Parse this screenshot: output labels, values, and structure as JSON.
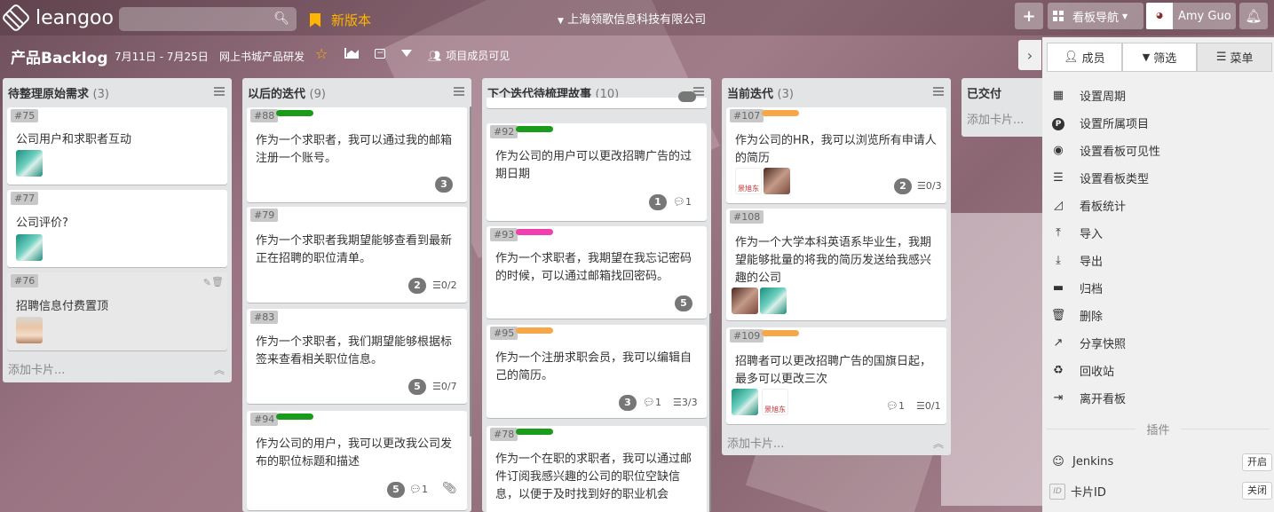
{
  "app": {
    "logo": "leangoo",
    "new_version": "新版本",
    "company": "上海领歌信息科技有限公司",
    "board_nav": "看板导航",
    "user_name": "Amy Guo"
  },
  "board": {
    "title": "产品Backlog",
    "date_range": "7月11日 - 7月25日",
    "project": "网上书城产品研发",
    "members_visibility": "项目成员可见"
  },
  "lists": [
    {
      "title": "待整理原始需求",
      "count": "(3)",
      "add_card": "添加卡片...",
      "cards": [
        {
          "id": "#75",
          "text": "公司用户和求职者互动"
        },
        {
          "id": "#77",
          "text": "公司评价?"
        },
        {
          "id": "#76",
          "text": "招聘信息付费置顶"
        }
      ]
    },
    {
      "title": "以后的迭代",
      "count": "(9)",
      "cards": [
        {
          "id": "#88",
          "text": "作为一个求职者，我可以通过我的邮箱注册一个账号。",
          "badge": "3",
          "label_color": "#1a9c1a"
        },
        {
          "id": "#79",
          "text": "作为一个求职者我期望能够查看到最新正在招聘的职位清单。",
          "badge": "2",
          "checklist": "0/2"
        },
        {
          "id": "#83",
          "text": "作为一个求职者，我们期望能够根据标签来查看相关职位信息。",
          "badge": "5",
          "checklist": "0/7"
        },
        {
          "id": "#94",
          "text": "作为公司的用户，我可以更改我公司发布的职位标题和描述",
          "badge": "5",
          "comments": "1",
          "label_color": "#1a9c1a"
        }
      ]
    },
    {
      "title": "下个迭代待梳理故事",
      "count": "(10)",
      "cards": [
        {
          "id": "#92",
          "text": "作为公司的用户可以更改招聘广告的过期日期",
          "badge": "1",
          "comments": "1",
          "label_color": "#1a9c1a"
        },
        {
          "id": "#93",
          "text": "作为一个求职者，我期望在我忘记密码的时候，可以通过邮箱找回密码。",
          "badge": "5",
          "label_color": "#f03fae"
        },
        {
          "id": "#95",
          "text": "作为一个注册求职会员，我可以编辑自己的简历。",
          "badge": "3",
          "comments": "1",
          "checklist": "3/3",
          "label_color": "#f5a74a"
        },
        {
          "id": "#78",
          "text": "作为一个在职的求职者，我可以通过邮件订阅我感兴趣的公司的职位空缺信息，以便于及时找到好的职业机会",
          "label_color": "#1a9c1a"
        }
      ]
    },
    {
      "title": "当前迭代",
      "count": "(3)",
      "add_card": "添加卡片...",
      "cards": [
        {
          "id": "#107",
          "text": "作为公司的HR，我可以浏览所有申请人的简历",
          "badge": "2",
          "checklist": "0/3",
          "label_color": "#f5a74a"
        },
        {
          "id": "#108",
          "text": "作为一个大学本科英语系毕业生，我期望能够批量的将我的简历发送给我感兴趣的公司"
        },
        {
          "id": "#109",
          "text": "招聘者可以更改招聘广告的国旗日起，最多可以更改三次",
          "comments": "1",
          "checklist": "0/1",
          "label_color": "#f5a74a"
        }
      ]
    },
    {
      "title": "已交付",
      "count": "",
      "add_card": "添加卡片..."
    }
  ],
  "avatar_caption": "景旭东",
  "panel": {
    "tabs": [
      "成员",
      "筛选",
      "菜单"
    ],
    "menu": [
      "设置周期",
      "设置所属项目",
      "设置看板可见性",
      "设置看板类型",
      "看板统计",
      "导入",
      "导出",
      "归档",
      "删除",
      "分享快照",
      "回收站",
      "离开看板"
    ],
    "plugins_title": "插件",
    "plugins": [
      {
        "name": "Jenkins",
        "action": "开启"
      },
      {
        "name": "卡片ID",
        "action": "关闭",
        "icon_text": "ID"
      }
    ]
  }
}
